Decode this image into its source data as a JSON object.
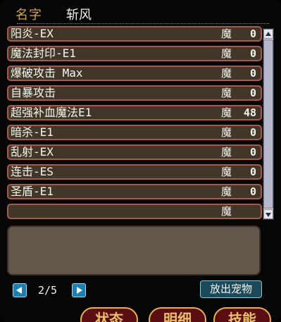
{
  "header": {
    "name_label": "名字",
    "name_value": "斩风"
  },
  "skills": [
    {
      "name": "阳炎-EX",
      "mo": "魔",
      "value": "0"
    },
    {
      "name": "魔法封印-E1",
      "mo": "魔",
      "value": "0"
    },
    {
      "name": "爆破攻击 Max",
      "mo": "魔",
      "value": "0"
    },
    {
      "name": "自暴攻击",
      "mo": "魔",
      "value": "0"
    },
    {
      "name": "超强补血魔法E1",
      "mo": "魔",
      "value": "48"
    },
    {
      "name": "暗杀-E1",
      "mo": "魔",
      "value": "0"
    },
    {
      "name": "乱射-EX",
      "mo": "魔",
      "value": "0"
    },
    {
      "name": "连击-ES",
      "mo": "魔",
      "value": "0"
    },
    {
      "name": "圣盾-E1",
      "mo": "魔",
      "value": "0"
    },
    {
      "name": "",
      "mo": "魔",
      "value": ""
    }
  ],
  "pager": {
    "text": "2/5"
  },
  "release_button": "放出宠物",
  "tabs": [
    "状态",
    "明细",
    "技能"
  ]
}
